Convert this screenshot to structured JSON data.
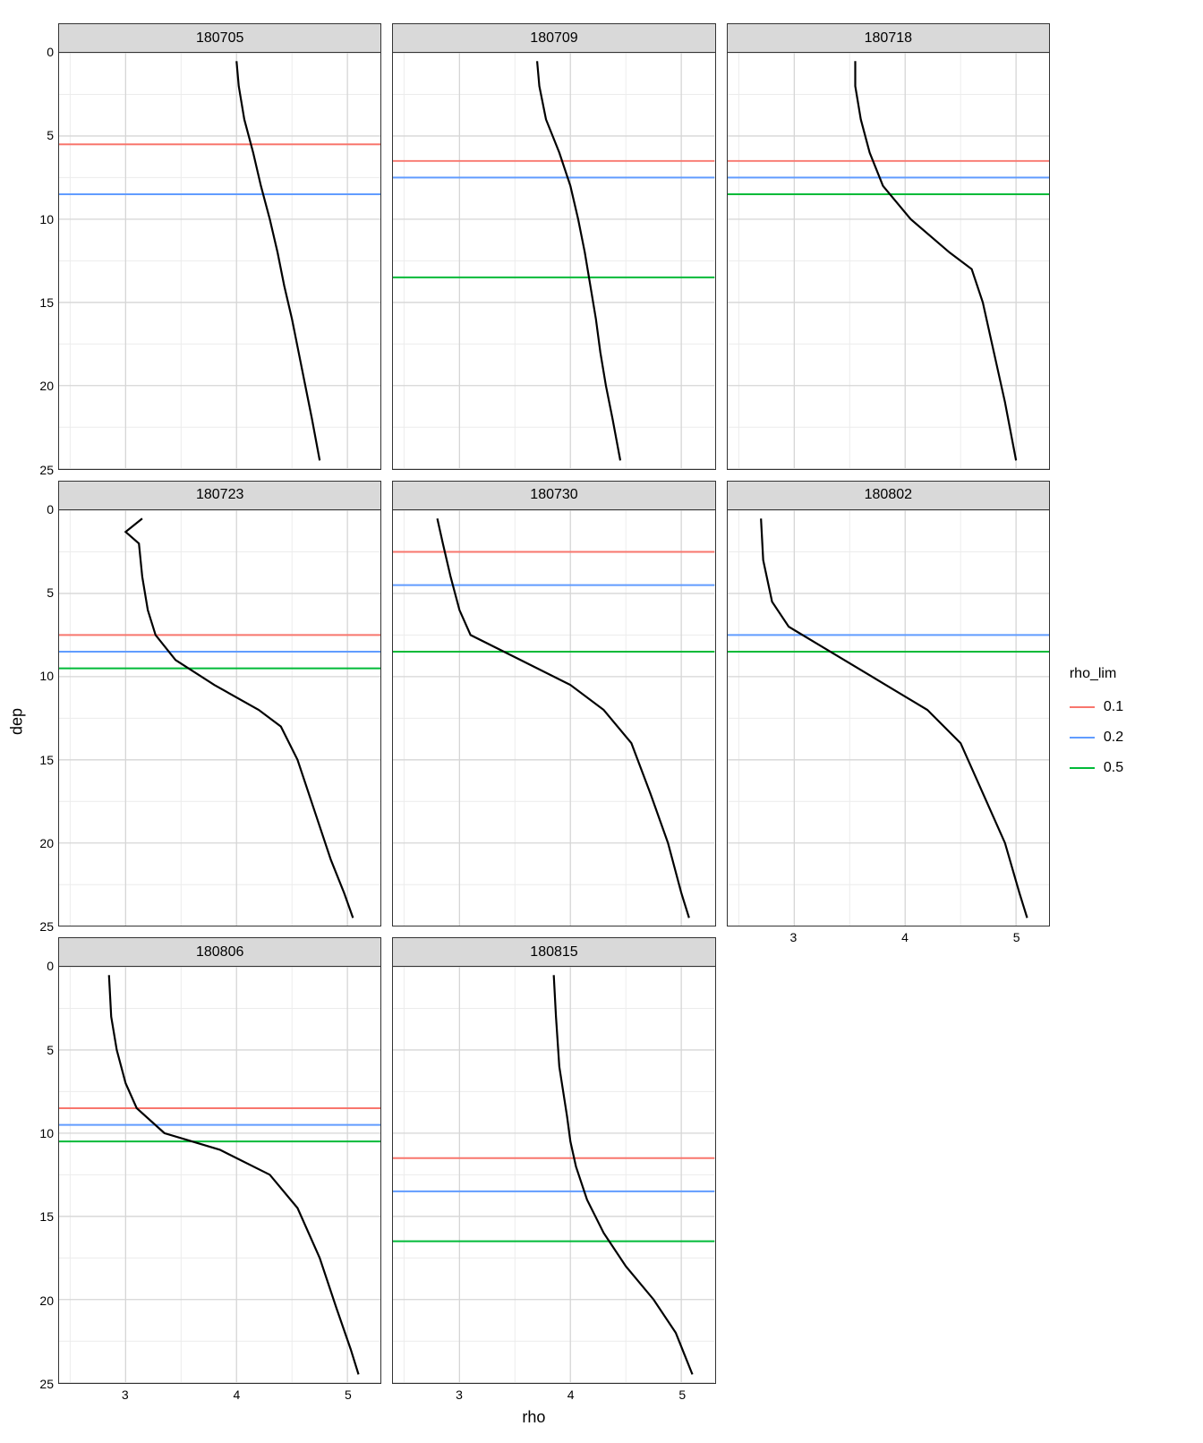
{
  "chart_data": {
    "type": "line",
    "layout": "facet_grid_3x3_last_row_2",
    "xlabel": "rho",
    "ylabel": "dep",
    "xlim": [
      2.4,
      5.3
    ],
    "ylim": [
      25,
      0
    ],
    "x_ticks": [
      3,
      4,
      5
    ],
    "y_ticks": [
      0,
      5,
      10,
      15,
      20,
      25
    ],
    "x_minor_ticks": [
      2.5,
      3.5,
      4.5
    ],
    "y_minor_ticks": [
      2.5,
      7.5,
      12.5,
      17.5,
      22.5
    ],
    "legend": {
      "title": "rho_lim",
      "items": [
        {
          "label": "0.1",
          "color": "#F8766D"
        },
        {
          "label": "0.2",
          "color": "#619CFF"
        },
        {
          "label": "0.5",
          "color": "#00BA38"
        }
      ]
    },
    "panels": [
      {
        "facet": "180705",
        "profile": [
          {
            "rho": 4.0,
            "dep": 0.5
          },
          {
            "rho": 4.02,
            "dep": 2.0
          },
          {
            "rho": 4.07,
            "dep": 4.0
          },
          {
            "rho": 4.15,
            "dep": 6.0
          },
          {
            "rho": 4.22,
            "dep": 8.0
          },
          {
            "rho": 4.3,
            "dep": 10.0
          },
          {
            "rho": 4.37,
            "dep": 12.0
          },
          {
            "rho": 4.43,
            "dep": 14.0
          },
          {
            "rho": 4.5,
            "dep": 16.0
          },
          {
            "rho": 4.56,
            "dep": 18.0
          },
          {
            "rho": 4.62,
            "dep": 20.0
          },
          {
            "rho": 4.68,
            "dep": 22.0
          },
          {
            "rho": 4.75,
            "dep": 24.5
          }
        ],
        "hlines": {
          "0.1": 5.5,
          "0.2": 8.5,
          "0.5": null
        }
      },
      {
        "facet": "180709",
        "profile": [
          {
            "rho": 3.7,
            "dep": 0.5
          },
          {
            "rho": 3.72,
            "dep": 2.0
          },
          {
            "rho": 3.78,
            "dep": 4.0
          },
          {
            "rho": 3.9,
            "dep": 6.0
          },
          {
            "rho": 4.0,
            "dep": 8.0
          },
          {
            "rho": 4.07,
            "dep": 10.0
          },
          {
            "rho": 4.13,
            "dep": 12.0
          },
          {
            "rho": 4.18,
            "dep": 14.0
          },
          {
            "rho": 4.23,
            "dep": 16.0
          },
          {
            "rho": 4.27,
            "dep": 18.0
          },
          {
            "rho": 4.32,
            "dep": 20.0
          },
          {
            "rho": 4.38,
            "dep": 22.0
          },
          {
            "rho": 4.45,
            "dep": 24.5
          }
        ],
        "hlines": {
          "0.1": 6.5,
          "0.2": 7.5,
          "0.5": 13.5
        }
      },
      {
        "facet": "180718",
        "profile": [
          {
            "rho": 3.55,
            "dep": 0.5
          },
          {
            "rho": 3.55,
            "dep": 2.0
          },
          {
            "rho": 3.6,
            "dep": 4.0
          },
          {
            "rho": 3.68,
            "dep": 6.0
          },
          {
            "rho": 3.8,
            "dep": 8.0
          },
          {
            "rho": 4.05,
            "dep": 10.0
          },
          {
            "rho": 4.4,
            "dep": 12.0
          },
          {
            "rho": 4.6,
            "dep": 13.0
          },
          {
            "rho": 4.7,
            "dep": 15.0
          },
          {
            "rho": 4.8,
            "dep": 18.0
          },
          {
            "rho": 4.9,
            "dep": 21.0
          },
          {
            "rho": 5.0,
            "dep": 24.5
          }
        ],
        "hlines": {
          "0.1": 6.5,
          "0.2": 7.5,
          "0.5": 8.5
        }
      },
      {
        "facet": "180723",
        "profile": [
          {
            "rho": 3.15,
            "dep": 0.5
          },
          {
            "rho": 3.0,
            "dep": 1.3
          },
          {
            "rho": 3.12,
            "dep": 2.0
          },
          {
            "rho": 3.15,
            "dep": 4.0
          },
          {
            "rho": 3.2,
            "dep": 6.0
          },
          {
            "rho": 3.27,
            "dep": 7.5
          },
          {
            "rho": 3.45,
            "dep": 9.0
          },
          {
            "rho": 3.8,
            "dep": 10.5
          },
          {
            "rho": 4.2,
            "dep": 12.0
          },
          {
            "rho": 4.4,
            "dep": 13.0
          },
          {
            "rho": 4.55,
            "dep": 15.0
          },
          {
            "rho": 4.7,
            "dep": 18.0
          },
          {
            "rho": 4.85,
            "dep": 21.0
          },
          {
            "rho": 4.97,
            "dep": 23.0
          },
          {
            "rho": 5.05,
            "dep": 24.5
          }
        ],
        "hlines": {
          "0.1": 7.5,
          "0.2": 8.5,
          "0.5": 9.5
        }
      },
      {
        "facet": "180730",
        "profile": [
          {
            "rho": 2.8,
            "dep": 0.5
          },
          {
            "rho": 2.85,
            "dep": 2.0
          },
          {
            "rho": 2.92,
            "dep": 4.0
          },
          {
            "rho": 3.0,
            "dep": 6.0
          },
          {
            "rho": 3.1,
            "dep": 7.5
          },
          {
            "rho": 3.55,
            "dep": 9.0
          },
          {
            "rho": 4.0,
            "dep": 10.5
          },
          {
            "rho": 4.3,
            "dep": 12.0
          },
          {
            "rho": 4.55,
            "dep": 14.0
          },
          {
            "rho": 4.72,
            "dep": 17.0
          },
          {
            "rho": 4.88,
            "dep": 20.0
          },
          {
            "rho": 5.0,
            "dep": 23.0
          },
          {
            "rho": 5.07,
            "dep": 24.5
          }
        ],
        "hlines": {
          "0.1": 2.5,
          "0.2": 4.5,
          "0.5": 8.5
        }
      },
      {
        "facet": "180802",
        "profile": [
          {
            "rho": 2.7,
            "dep": 0.5
          },
          {
            "rho": 2.72,
            "dep": 3.0
          },
          {
            "rho": 2.8,
            "dep": 5.5
          },
          {
            "rho": 2.95,
            "dep": 7.0
          },
          {
            "rho": 3.2,
            "dep": 8.0
          },
          {
            "rho": 3.7,
            "dep": 10.0
          },
          {
            "rho": 4.2,
            "dep": 12.0
          },
          {
            "rho": 4.5,
            "dep": 14.0
          },
          {
            "rho": 4.7,
            "dep": 17.0
          },
          {
            "rho": 4.9,
            "dep": 20.0
          },
          {
            "rho": 5.03,
            "dep": 23.0
          },
          {
            "rho": 5.1,
            "dep": 24.5
          }
        ],
        "hlines": {
          "0.1": null,
          "0.2": 7.5,
          "0.5": 8.5
        }
      },
      {
        "facet": "180806",
        "profile": [
          {
            "rho": 2.85,
            "dep": 0.5
          },
          {
            "rho": 2.87,
            "dep": 3.0
          },
          {
            "rho": 2.92,
            "dep": 5.0
          },
          {
            "rho": 3.0,
            "dep": 7.0
          },
          {
            "rho": 3.1,
            "dep": 8.5
          },
          {
            "rho": 3.35,
            "dep": 10.0
          },
          {
            "rho": 3.85,
            "dep": 11.0
          },
          {
            "rho": 4.3,
            "dep": 12.5
          },
          {
            "rho": 4.55,
            "dep": 14.5
          },
          {
            "rho": 4.75,
            "dep": 17.5
          },
          {
            "rho": 4.9,
            "dep": 20.5
          },
          {
            "rho": 5.03,
            "dep": 23.0
          },
          {
            "rho": 5.1,
            "dep": 24.5
          }
        ],
        "hlines": {
          "0.1": 8.5,
          "0.2": 9.5,
          "0.5": 10.5
        }
      },
      {
        "facet": "180815",
        "profile": [
          {
            "rho": 3.85,
            "dep": 0.5
          },
          {
            "rho": 3.87,
            "dep": 3.0
          },
          {
            "rho": 3.9,
            "dep": 6.0
          },
          {
            "rho": 3.97,
            "dep": 9.0
          },
          {
            "rho": 4.0,
            "dep": 10.5
          },
          {
            "rho": 4.05,
            "dep": 12.0
          },
          {
            "rho": 4.15,
            "dep": 14.0
          },
          {
            "rho": 4.3,
            "dep": 16.0
          },
          {
            "rho": 4.5,
            "dep": 18.0
          },
          {
            "rho": 4.75,
            "dep": 20.0
          },
          {
            "rho": 4.95,
            "dep": 22.0
          },
          {
            "rho": 5.1,
            "dep": 24.5
          }
        ],
        "hlines": {
          "0.1": 11.5,
          "0.2": 13.5,
          "0.5": 16.5
        }
      }
    ]
  }
}
